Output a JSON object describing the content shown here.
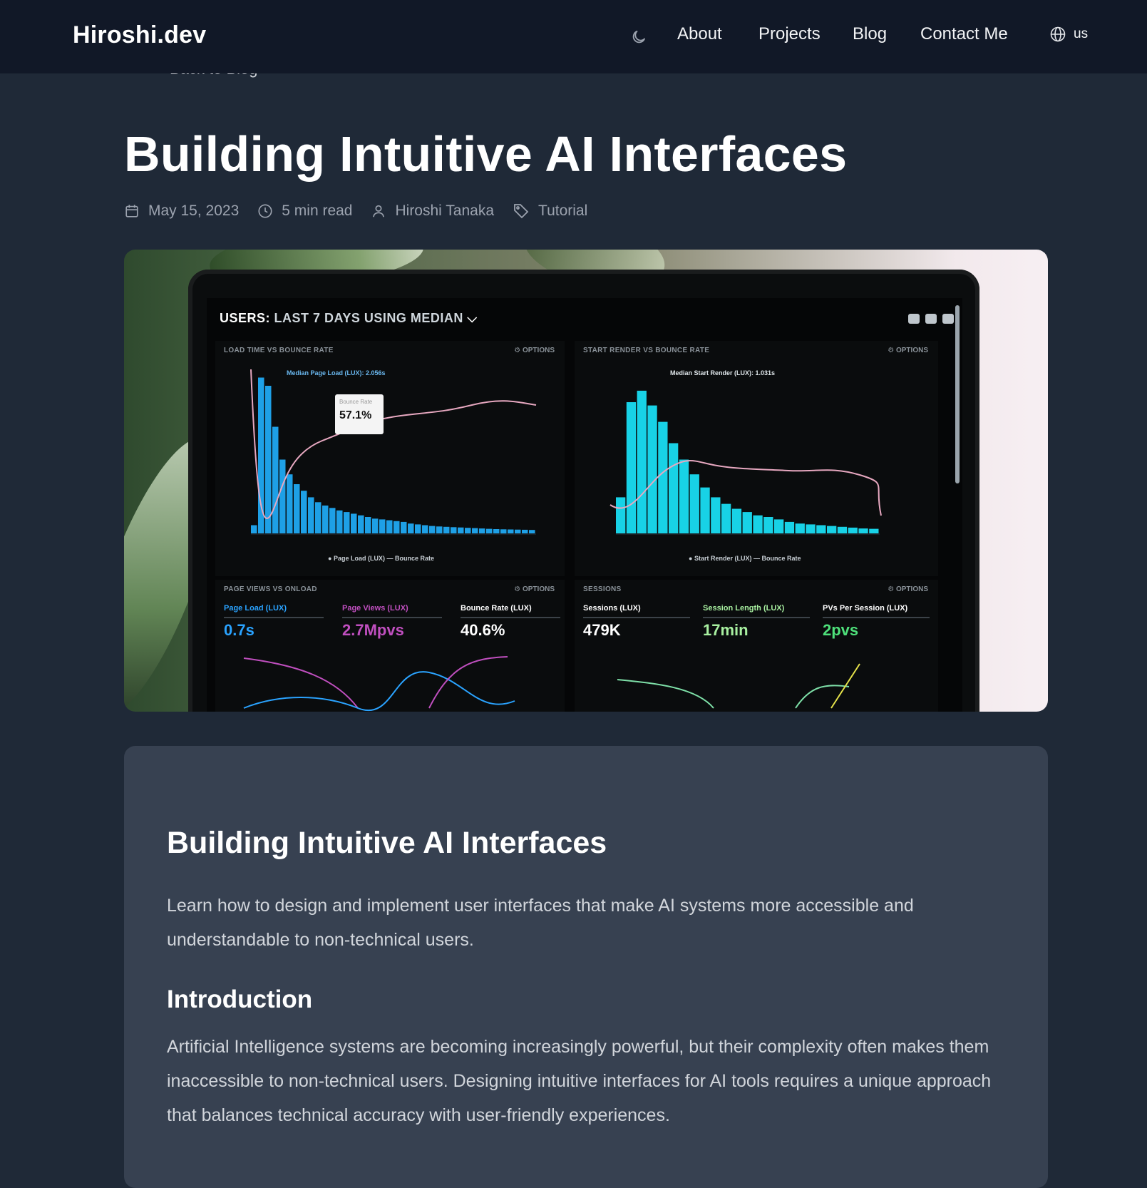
{
  "nav": {
    "brand": "Hiroshi.dev",
    "theme_icon": "moon-icon",
    "links": [
      "About",
      "Projects",
      "Blog",
      "Contact Me"
    ],
    "language_icon": "globe-icon",
    "language": "us"
  },
  "back_link": "Back to Blog",
  "article": {
    "title": "Building Intuitive AI Interfaces",
    "date": "May 15, 2023",
    "read_time": "5 min read",
    "author": "Hiroshi Tanaka",
    "tag": "Tutorial"
  },
  "hero_image": {
    "dashboard_title_bold": "USERS:",
    "dashboard_title_rest": "LAST 7 DAYS USING MEDIAN",
    "panel1_label": "LOAD TIME VS BOUNCE RATE",
    "panel2_label": "START RENDER VS BOUNCE RATE",
    "panel3_label": "PAGE VIEWS VS ONLOAD",
    "panel4_label": "SESSIONS",
    "options_label": "OPTIONS",
    "panel1_median": "Median Page Load (LUX): 2.056s",
    "panel2_median": "Median Start Render (LUX): 1.031s",
    "tooltip_label": "Bounce Rate",
    "tooltip_value": "57.1%",
    "panel1_legend": [
      "Page Load (LUX)",
      "Bounce Rate"
    ],
    "panel2_legend": [
      "Start Render (LUX)",
      "Bounce Rate"
    ],
    "panel1_bars": [
      0.05,
      0.95,
      0.9,
      0.65,
      0.45,
      0.36,
      0.3,
      0.26,
      0.22,
      0.19,
      0.17,
      0.155,
      0.14,
      0.13,
      0.12,
      0.11,
      0.1,
      0.09,
      0.085,
      0.08,
      0.075,
      0.07,
      0.06,
      0.055,
      0.05,
      0.045,
      0.042,
      0.04,
      0.038,
      0.036,
      0.034,
      0.032,
      0.03,
      0.028,
      0.026,
      0.025,
      0.024,
      0.023,
      0.022,
      0.021
    ],
    "panel2_bars": [
      0.22,
      0.8,
      0.87,
      0.78,
      0.68,
      0.55,
      0.45,
      0.36,
      0.28,
      0.22,
      0.18,
      0.15,
      0.13,
      0.11,
      0.1,
      0.085,
      0.07,
      0.06,
      0.055,
      0.05,
      0.045,
      0.04,
      0.035,
      0.03,
      0.028
    ],
    "stats": [
      {
        "label": "Page Load (LUX)",
        "value": "0.7s",
        "color": "#2aa3ff"
      },
      {
        "label": "Page Views (LUX)",
        "value": "2.7Mpvs",
        "color": "#c04fbf"
      },
      {
        "label": "Bounce Rate (LUX)",
        "value": "40.6%",
        "color": "#ffffff"
      },
      {
        "label": "Sessions (LUX)",
        "value": "479K",
        "color": "#ffffff"
      },
      {
        "label": "Session Length (LUX)",
        "value": "17min",
        "color": "#a8f0a0"
      },
      {
        "label": "PVs Per Session (LUX)",
        "value": "2pvs",
        "color": "#4ee07a"
      }
    ]
  },
  "content": {
    "heading": "Building Intuitive AI Interfaces",
    "lead": "Learn how to design and implement user interfaces that make AI systems more accessible and understandable to non-technical users.",
    "section_heading": "Introduction",
    "section_body": "Artificial Intelligence systems are becoming increasingly powerful, but their complexity often makes them inaccessible to non-technical users. Designing intuitive interfaces for AI tools requires a unique approach that balances technical accuracy with user-friendly experiences."
  },
  "colors": {
    "nav_bg": "#111827",
    "page_bg": "#1f2937",
    "card_bg": "#374151",
    "bar_blue": "#1ea0e6",
    "bar_cyan": "#18d2e6",
    "bounce_line": "#e7a8c0"
  }
}
